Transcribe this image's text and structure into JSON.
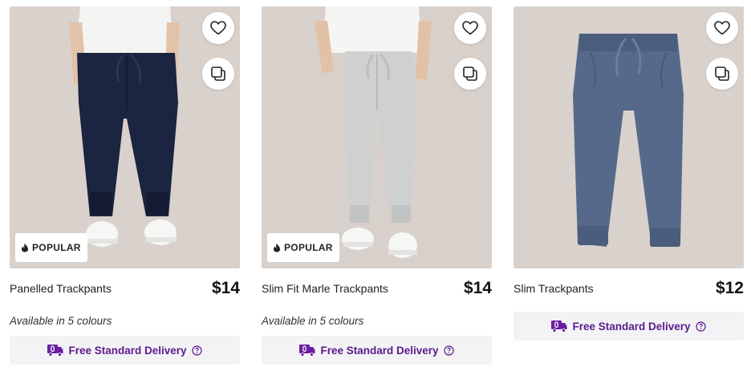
{
  "products": [
    {
      "name": "Panelled Trackpants",
      "price": "$14",
      "badge": "POPULAR",
      "colours": "Available in 5 colours",
      "delivery": "Free Standard Delivery",
      "pants_color": "#1b2440"
    },
    {
      "name": "Slim Fit Marle Trackpants",
      "price": "$14",
      "badge": "POPULAR",
      "colours": "Available in 5 colours",
      "delivery": "Free Standard Delivery",
      "pants_color": "#cfd0d0"
    },
    {
      "name": "Slim Trackpants",
      "price": "$12",
      "badge": "",
      "colours": "",
      "delivery": "Free Standard Delivery",
      "pants_color": "#56698a"
    }
  ],
  "icons": {
    "favourite": "heart-icon",
    "compare": "compare-icon",
    "popular": "flame-icon",
    "delivery": "delivery-truck-icon",
    "info": "info-icon"
  },
  "colors": {
    "delivery_text": "#5b1a8c",
    "delivery_bg": "#f3f3f5",
    "photo_bg": "#d8d1cb"
  }
}
